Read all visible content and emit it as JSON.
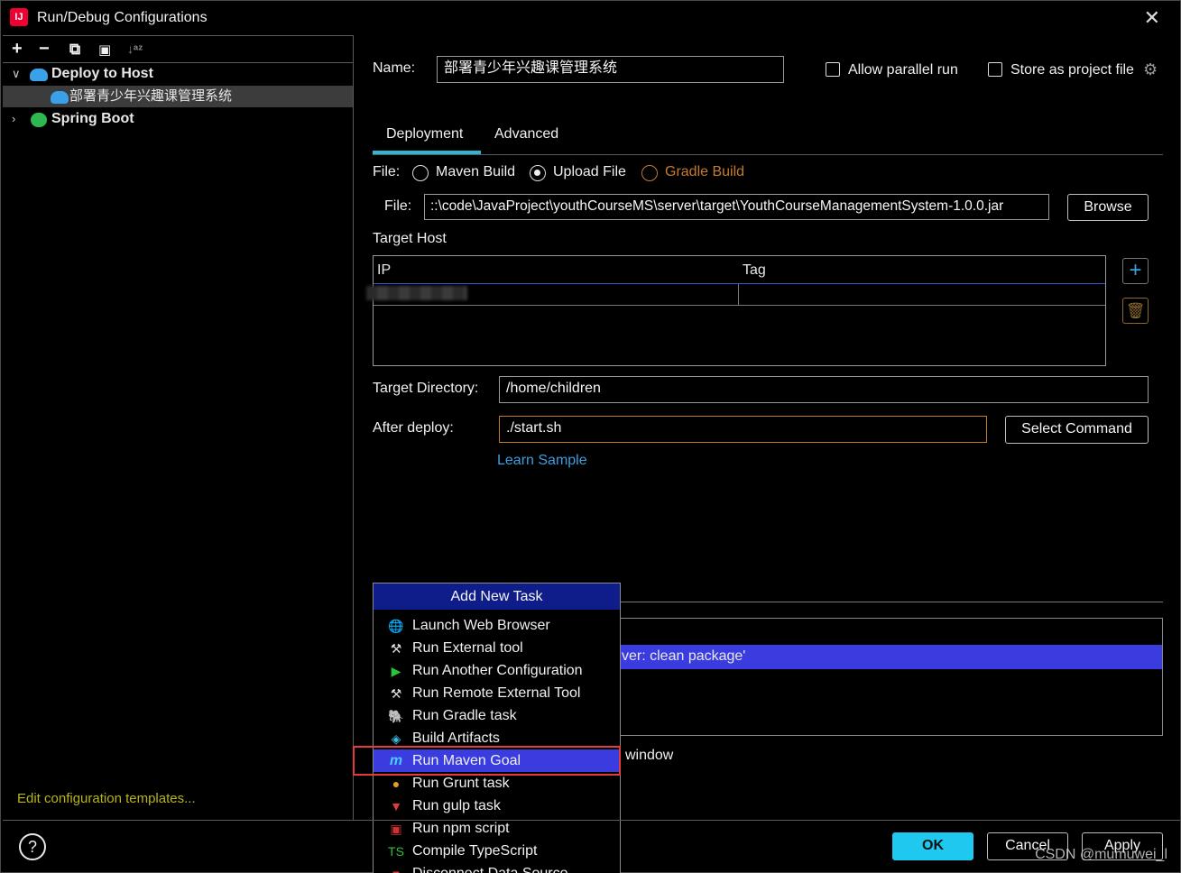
{
  "window": {
    "title": "Run/Debug Configurations"
  },
  "toolbar": {
    "add": "+",
    "remove": "−",
    "copy": "⧉",
    "folder": "📁",
    "sort": "↓a z"
  },
  "tree": {
    "deploy_group": "Deploy to Host",
    "deploy_child": "部署青少年兴趣课管理系统",
    "spring_group": "Spring Boot"
  },
  "edit_templates": "Edit configuration templates...",
  "form": {
    "name_label": "Name:",
    "name_value": "部署青少年兴趣课管理系统",
    "allow_parallel": "Allow parallel run",
    "store_project": "Store as project file",
    "tabs": [
      "Deployment",
      "Advanced"
    ],
    "file_label": "File:",
    "file_options": [
      "Maven Build",
      "Upload File",
      "Gradle Build"
    ],
    "file_path_label": "File:",
    "file_path": "::\\code\\JavaProject\\youthCourseMS\\server\\target\\YouthCourseManagementSystem-1.0.0.jar",
    "browse": "Browse",
    "target_host": "Target Host",
    "col_ip": "IP",
    "col_tag": "Tag",
    "add_host": "+",
    "target_dir_label": "Target Directory:",
    "target_dir": "/home/children",
    "after_deploy_label": "After deploy:",
    "after_deploy": "./start.sh",
    "select_command": "Select Command",
    "learn_sample": "Learn Sample",
    "before_launch_task": "ver: clean package'",
    "window_text": "window"
  },
  "popup": {
    "header": "Add New Task",
    "items": [
      "Launch Web Browser",
      "Run External tool",
      "Run Another Configuration",
      "Run Remote External Tool",
      "Run Gradle task",
      "Build Artifacts",
      "Run Maven Goal",
      "Run Grunt task",
      "Run gulp task",
      "Run npm script",
      "Compile TypeScript",
      "Disconnect Data Source"
    ]
  },
  "buttons": {
    "ok": "OK",
    "cancel": "Cancel",
    "apply": "Apply",
    "help": "?"
  },
  "watermark": "CSDN @mumuwei_l",
  "colors": {
    "accent": "#2fb6d4",
    "popup_header": "#0f1d8a",
    "highlight": "#3a3ce0",
    "ok_button": "#1ec8ee",
    "link": "#3a9fe0",
    "red_box": "#e23c3c"
  }
}
